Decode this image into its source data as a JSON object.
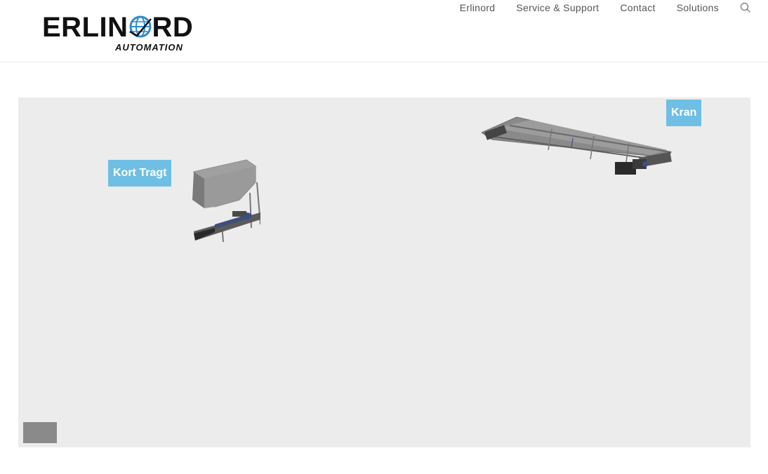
{
  "header": {
    "logo": {
      "word_start": "ERLIN",
      "word_end": "RD",
      "subtitle": "AUTOMATION"
    },
    "nav": [
      {
        "label": "Erlinord"
      },
      {
        "label": "Service & Support"
      },
      {
        "label": "Contact"
      },
      {
        "label": "Solutions"
      }
    ],
    "search_icon": "search-icon"
  },
  "viewer": {
    "background": "#ececec",
    "label_color": "#6fbfe4",
    "hotspots": [
      {
        "label": "Kort Tragt"
      },
      {
        "label": "Kran"
      }
    ]
  }
}
